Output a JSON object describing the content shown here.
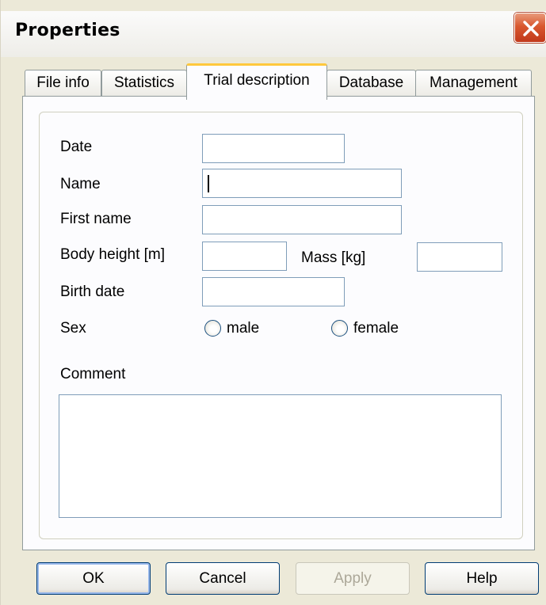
{
  "window": {
    "title": "Properties"
  },
  "tabs": [
    {
      "label": "File info"
    },
    {
      "label": "Statistics"
    },
    {
      "label": "Trial description"
    },
    {
      "label": "Database"
    },
    {
      "label": "Management"
    }
  ],
  "form": {
    "date_label": "Date",
    "date_value": "",
    "name_label": "Name",
    "name_value": "",
    "first_name_label": "First name",
    "first_name_value": "",
    "body_height_label": "Body height [m]",
    "body_height_value": "",
    "mass_label": "Mass [kg]",
    "mass_value": "",
    "birth_date_label": "Birth date",
    "birth_date_value": "",
    "sex_label": "Sex",
    "sex_options": [
      {
        "label": "male"
      },
      {
        "label": "female"
      }
    ],
    "comment_label": "Comment",
    "comment_value": ""
  },
  "buttons": {
    "ok": "OK",
    "cancel": "Cancel",
    "apply": "Apply",
    "help": "Help"
  },
  "colors": {
    "active_tab_highlight": "#ffc83c",
    "close_button": "#d9582e",
    "field_border": "#7f9db9"
  }
}
